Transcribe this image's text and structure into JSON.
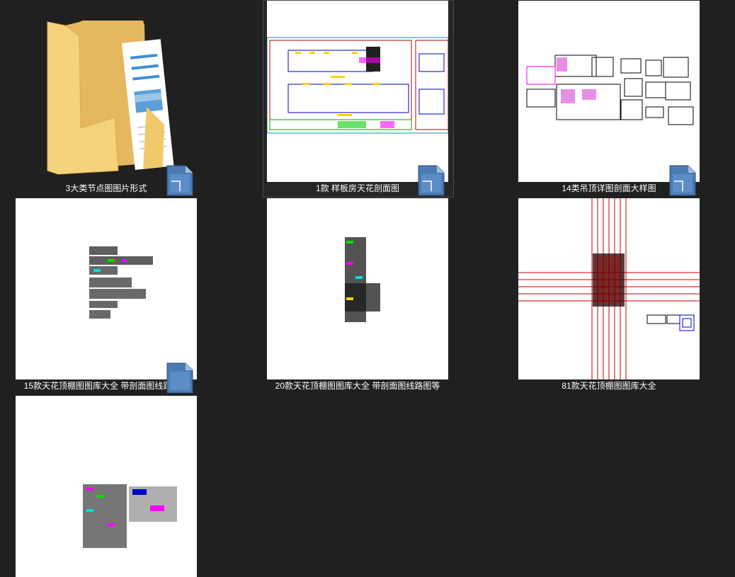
{
  "items": [
    {
      "name": "3大类节点图图片形式",
      "kind": "folder"
    },
    {
      "name": "1款 样板房天花剖面图",
      "kind": "dwg",
      "selected": true
    },
    {
      "name": "14类吊顶详图剖面大样图",
      "kind": "dwg"
    },
    {
      "name": "15款天花顶棚图图库大全 带剖面图线路图等",
      "kind": "dwg"
    },
    {
      "name": "20款天花顶棚图图库大全 带剖面图线路图等",
      "kind": "dwg"
    },
    {
      "name": "81款天花顶棚图图库大全",
      "kind": "dwg"
    },
    {
      "name": "",
      "kind": "dwg"
    }
  ],
  "colors": {
    "background": "#202020",
    "label": "#ffffff",
    "selection_border": "#4a4a4a"
  },
  "icons": {
    "folder": "folder-icon",
    "dwg": "dwg-file-icon"
  }
}
